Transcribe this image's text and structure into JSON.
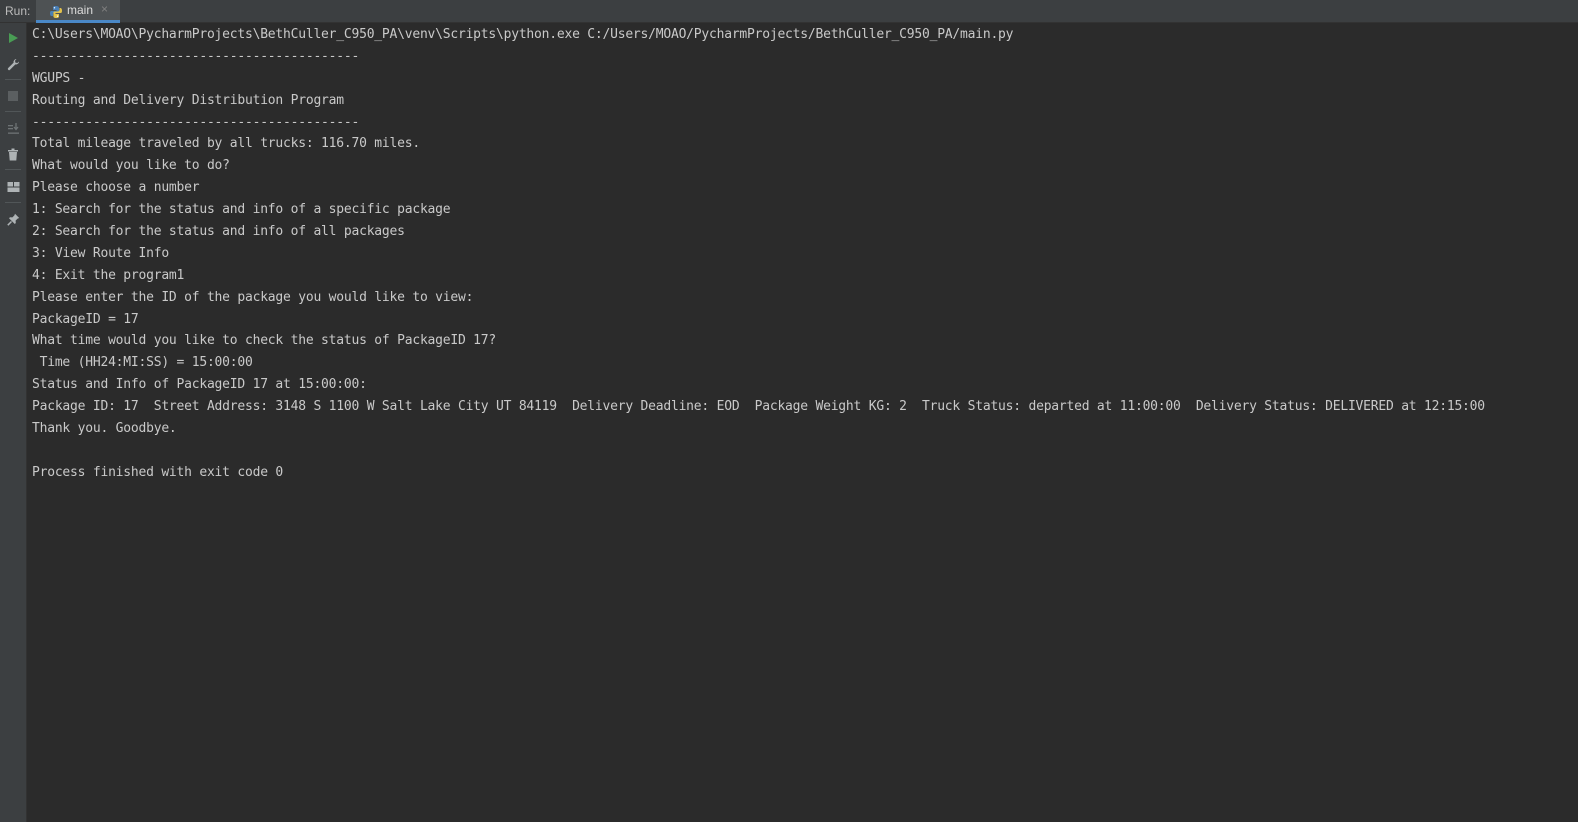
{
  "header": {
    "run_label": "Run:",
    "tab": {
      "label": "main",
      "icon": "python-icon",
      "close_glyph": "×"
    }
  },
  "toolbar": {
    "buttons": [
      {
        "name": "rerun-icon",
        "color": "#499c54"
      },
      {
        "name": "wrench-icon",
        "color": "#aeb3b5"
      },
      {
        "name": "stop-icon",
        "color": "#5b5f61"
      },
      {
        "name": "scroll-to-end-icon",
        "color": "#6e7375"
      },
      {
        "name": "trash-icon",
        "color": "#aeb3b5"
      },
      {
        "name": "layout-icon",
        "color": "#aeb3b5"
      },
      {
        "name": "pin-icon",
        "color": "#aeb3b5"
      }
    ]
  },
  "console": {
    "lines": [
      "C:\\Users\\MOAO\\PycharmProjects\\BethCuller_C950_PA\\venv\\Scripts\\python.exe C:/Users/MOAO/PycharmProjects/BethCuller_C950_PA/main.py",
      "-------------------------------------------",
      "WGUPS -",
      "Routing and Delivery Distribution Program",
      "-------------------------------------------",
      "Total mileage traveled by all trucks: 116.70 miles.",
      "What would you like to do?",
      "Please choose a number",
      "1: Search for the status and info of a specific package",
      "2: Search for the status and info of all packages",
      "3: View Route Info",
      "4: Exit the program1",
      "Please enter the ID of the package you would like to view:",
      "PackageID = 17",
      "What time would you like to check the status of PackageID 17?",
      " Time (HH24:MI:SS) = 15:00:00",
      "Status and Info of PackageID 17 at 15:00:00:",
      "Package ID: 17  Street Address: 3148 S 1100 W Salt Lake City UT 84119  Delivery Deadline: EOD  Package Weight KG: 2  Truck Status: departed at 11:00:00  Delivery Status: DELIVERED at 12:15:00",
      "Thank you. Goodbye.",
      "",
      "Process finished with exit code 0"
    ]
  },
  "colors": {
    "background": "#2b2b2b",
    "panel": "#3c3f41",
    "text": "#c9c9c9",
    "tab_accent": "#4a88c7"
  }
}
